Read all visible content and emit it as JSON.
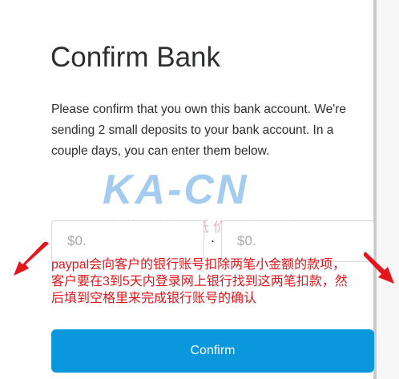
{
  "page": {
    "title": "Confirm Bank",
    "description": "Please confirm that you own this bank account. We're sending 2 small deposits to your bank account. In a couple days, you can enter them below."
  },
  "deposit_fields": {
    "amount1_placeholder": "$0.",
    "separator": ".",
    "amount2_placeholder": "$0."
  },
  "annotation": {
    "note": "paypal会向客户的银行账号扣除两笔小金额的款项，客户要在3到5天内登录网上银行找到这两笔扣款，然后填到空格里来完成银行账号的确认"
  },
  "watermark": {
    "title": "KA-CN",
    "subtitle": "海外最大最低价点卡商城"
  },
  "actions": {
    "confirm_label": "Confirm"
  },
  "colors": {
    "primary_button": "#0b97db",
    "annotation_text": "#e4161b",
    "watermark_blue": "#8ec0ec",
    "watermark_pink": "#e3abb1"
  }
}
